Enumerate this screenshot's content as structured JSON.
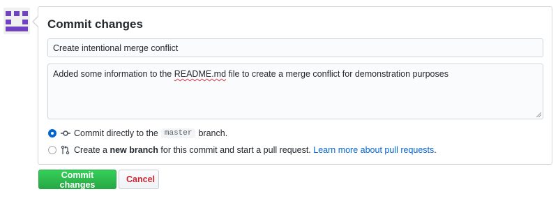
{
  "avatar": {
    "icon": "identicon-avatar",
    "color": "#6f42c1"
  },
  "commit_form": {
    "title": "Commit changes",
    "summary_value": "Create intentional merge conflict",
    "description": {
      "before": "Added some information to the ",
      "misspelled": "README.md",
      "after": " file to create a merge conflict for demonstration purposes"
    },
    "options": [
      {
        "selected": true,
        "icon": "git-commit-icon",
        "text_before": "Commit directly to the",
        "branch": "master",
        "text_after": "branch."
      },
      {
        "selected": false,
        "icon": "git-pull-request-icon",
        "text_before": "Create a",
        "bold": "new branch",
        "text_middle": "for this commit and start a pull request.",
        "link": "Learn more about pull requests",
        "text_after": "."
      }
    ]
  },
  "buttons": {
    "commit": "Commit changes",
    "cancel": "Cancel"
  },
  "colors": {
    "primary": "#28a745",
    "danger": "#cb2431",
    "link": "#0366d6",
    "radio_selected": "#0366d6"
  }
}
